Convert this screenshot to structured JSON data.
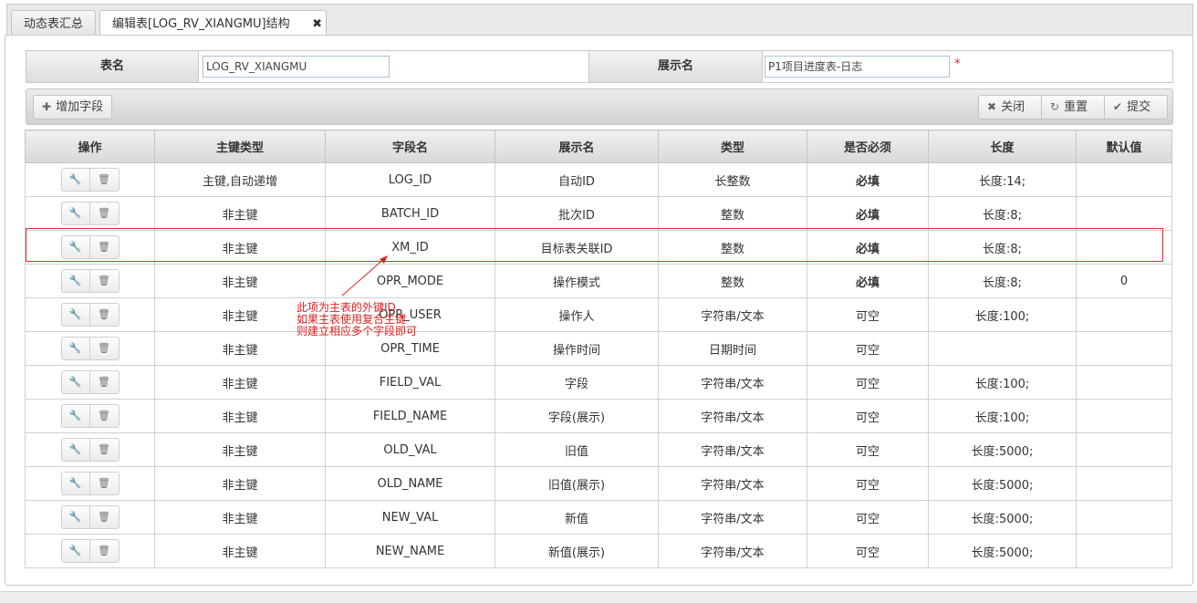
{
  "tabs": [
    {
      "label": "动态表汇总"
    },
    {
      "label": "编辑表[LOG_RV_XIANGMU]结构",
      "close": "✖"
    }
  ],
  "form": {
    "table_name_label": "表名",
    "table_name_value": "LOG_RV_XIANGMU",
    "display_name_label": "展示名",
    "display_name_value": "P1项目进度表-日志",
    "required_mark": "*"
  },
  "toolbar": {
    "add_label": "增加字段",
    "close_label": "关闭",
    "reset_label": "重置",
    "submit_label": "提交"
  },
  "table": {
    "headers": [
      "操作",
      "主键类型",
      "字段名",
      "展示名",
      "类型",
      "是否必须",
      "长度",
      "默认值"
    ],
    "rows": [
      {
        "pk": "主键,自动递增",
        "field": "LOG_ID",
        "display": "自动ID",
        "type": "长整数",
        "required": "必填",
        "required_bold": true,
        "length": "长度:14;",
        "default": ""
      },
      {
        "pk": "非主键",
        "field": "BATCH_ID",
        "display": "批次ID",
        "type": "整数",
        "required": "必填",
        "required_bold": true,
        "length": "长度:8;",
        "default": ""
      },
      {
        "pk": "非主键",
        "field": "XM_ID",
        "display": "目标表关联ID",
        "type": "整数",
        "required": "必填",
        "required_bold": true,
        "length": "长度:8;",
        "default": ""
      },
      {
        "pk": "非主键",
        "field": "OPR_MODE",
        "display": "操作模式",
        "type": "整数",
        "required": "必填",
        "required_bold": true,
        "length": "长度:8;",
        "default": "0"
      },
      {
        "pk": "非主键",
        "field": "OPR_USER",
        "display": "操作人",
        "type": "字符串/文本",
        "required": "可空",
        "required_bold": false,
        "length": "长度:100;",
        "default": ""
      },
      {
        "pk": "非主键",
        "field": "OPR_TIME",
        "display": "操作时间",
        "type": "日期时间",
        "required": "可空",
        "required_bold": false,
        "length": "",
        "default": ""
      },
      {
        "pk": "非主键",
        "field": "FIELD_VAL",
        "display": "字段",
        "type": "字符串/文本",
        "required": "可空",
        "required_bold": false,
        "length": "长度:100;",
        "default": ""
      },
      {
        "pk": "非主键",
        "field": "FIELD_NAME",
        "display": "字段(展示)",
        "type": "字符串/文本",
        "required": "可空",
        "required_bold": false,
        "length": "长度:100;",
        "default": ""
      },
      {
        "pk": "非主键",
        "field": "OLD_VAL",
        "display": "旧值",
        "type": "字符串/文本",
        "required": "可空",
        "required_bold": false,
        "length": "长度:5000;",
        "default": ""
      },
      {
        "pk": "非主键",
        "field": "OLD_NAME",
        "display": "旧值(展示)",
        "type": "字符串/文本",
        "required": "可空",
        "required_bold": false,
        "length": "长度:5000;",
        "default": ""
      },
      {
        "pk": "非主键",
        "field": "NEW_VAL",
        "display": "新值",
        "type": "字符串/文本",
        "required": "可空",
        "required_bold": false,
        "length": "长度:5000;",
        "default": ""
      },
      {
        "pk": "非主键",
        "field": "NEW_NAME",
        "display": "新值(展示)",
        "type": "字符串/文本",
        "required": "可空",
        "required_bold": false,
        "length": "长度:5000;",
        "default": ""
      }
    ]
  },
  "annotation": {
    "lines": [
      "此项为主表的外键ID",
      "如果主表使用复合主键",
      "则建立相应多个字段即可"
    ],
    "color": "#e02020"
  },
  "icons": {
    "edit": "wrench-icon",
    "delete": "trash-icon",
    "add": "plus-icon",
    "close": "close-icon",
    "reset": "refresh-icon",
    "submit": "check-icon"
  }
}
